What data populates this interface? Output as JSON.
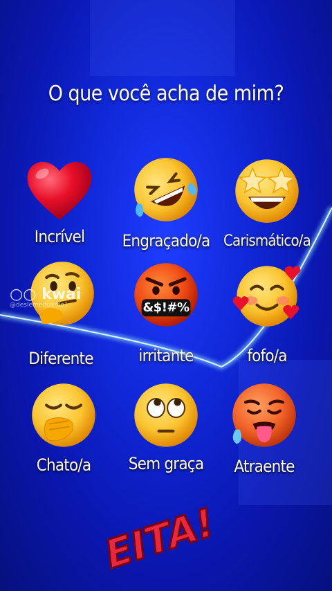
{
  "title": "O que você acha de mim?",
  "options": [
    {
      "label": "Incrível",
      "icon": "red-heart-icon"
    },
    {
      "label": "Engraçado/a",
      "icon": "rolling-on-floor-laughing-icon"
    },
    {
      "label": "Carismático/a",
      "icon": "star-struck-icon"
    },
    {
      "label": "Diferente",
      "icon": "thinking-face-icon"
    },
    {
      "label": "irritante",
      "icon": "angry-face-icon"
    },
    {
      "label": "fofo/a",
      "icon": "smiling-face-with-hearts-icon"
    },
    {
      "label": "Chato/a",
      "icon": "yawning-face-icon"
    },
    {
      "label": "Sem graça",
      "icon": "eye-roll-face-icon"
    },
    {
      "label": "Atraente",
      "icon": "hot-face-icon"
    }
  ],
  "angry_symbols": "&$!#%",
  "watermark": {
    "brand": "kwai",
    "user": "@deslemeduardo1"
  },
  "stamp_text": "EITA!",
  "colors": {
    "background": "#1028d8",
    "heart": "#e8102a",
    "emoji_yellow": "#fbc531",
    "stamp": "#e8283c"
  }
}
